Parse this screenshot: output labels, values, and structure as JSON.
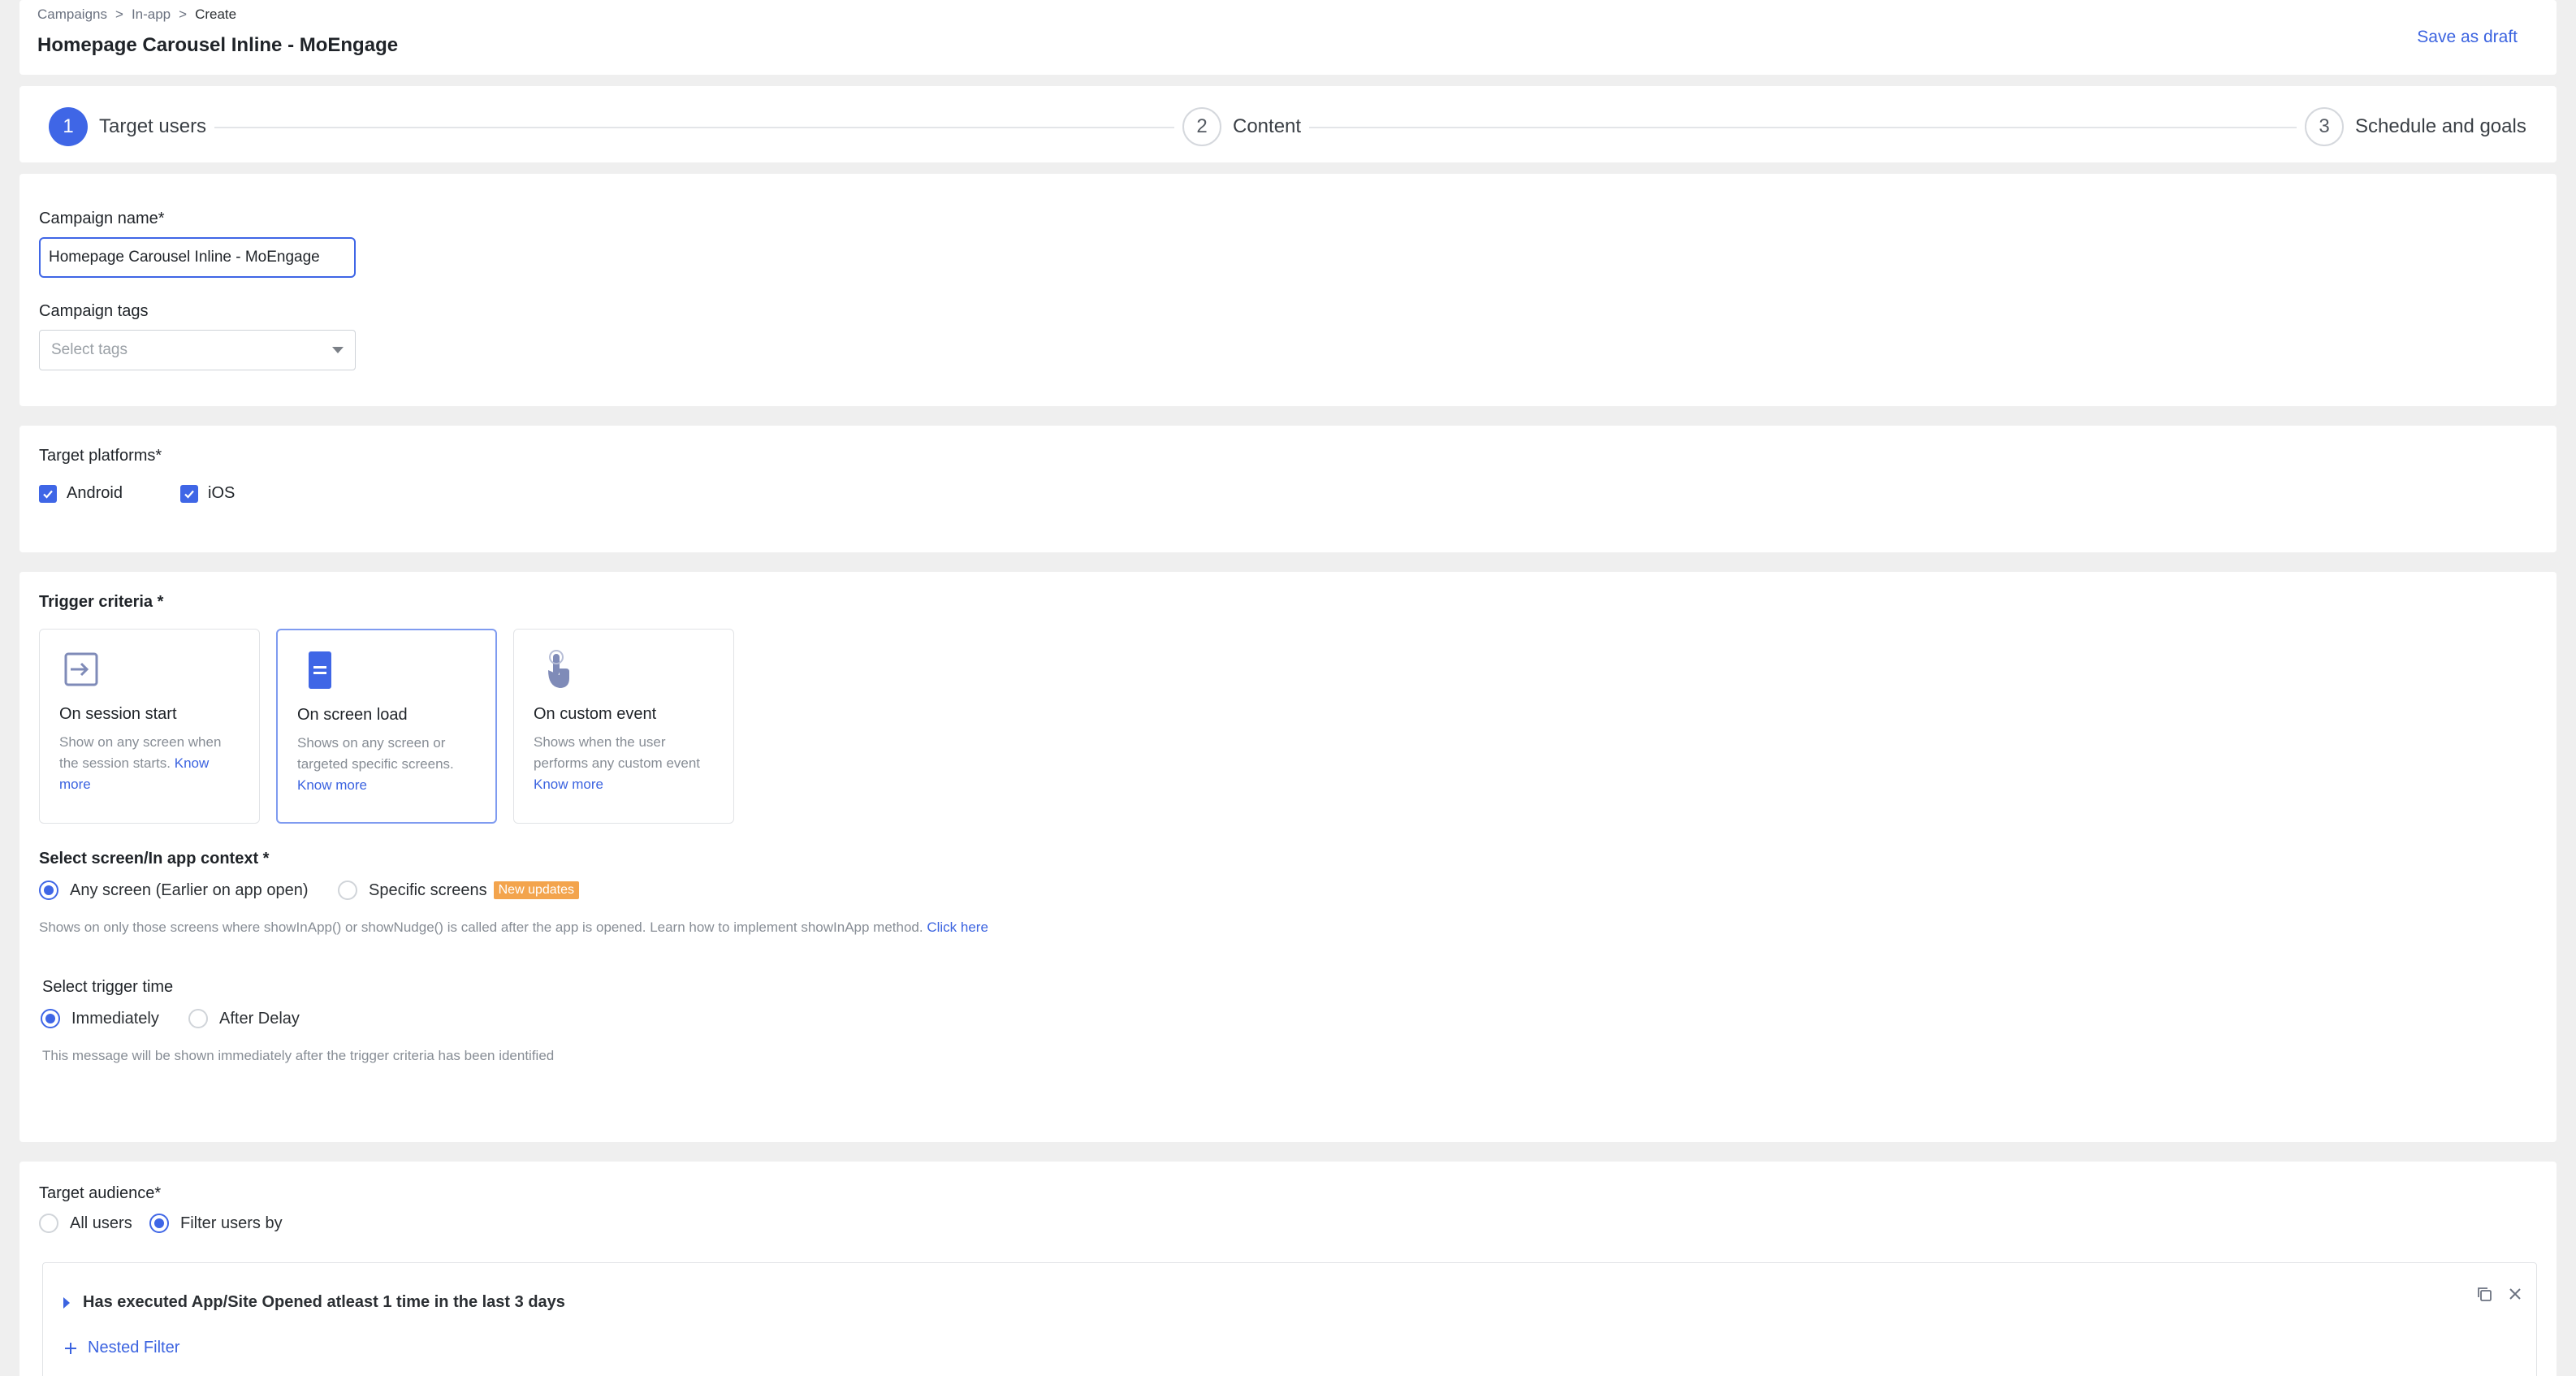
{
  "breadcrumb": [
    "Campaigns",
    ">",
    "In-app",
    ">",
    "Create"
  ],
  "page_title": "Homepage Carousel Inline - MoEngage",
  "save_draft_label": "Save as draft",
  "steps": [
    {
      "number": "1",
      "label": "Target users",
      "state": "active"
    },
    {
      "number": "2",
      "label": "Content",
      "state": "idle"
    },
    {
      "number": "3",
      "label": "Schedule and goals",
      "state": "idle"
    }
  ],
  "campaign": {
    "name_label": "Campaign name*",
    "name_value": "Homepage Carousel Inline - MoEngage",
    "tags_label": "Campaign tags",
    "tags_placeholder": "Select tags"
  },
  "platforms": {
    "label": "Target platforms*",
    "options": [
      {
        "label": "Android",
        "checked": true
      },
      {
        "label": "iOS",
        "checked": true
      }
    ]
  },
  "trigger": {
    "label": "Trigger criteria *",
    "cards": [
      {
        "title": "On session start",
        "desc": "Show on any screen when the session starts.",
        "link": "Know more",
        "icon": "session-start-icon",
        "selected": false
      },
      {
        "title": "On screen load",
        "desc": "Shows on any screen or targeted specific screens.",
        "link": "Know more",
        "icon": "screen-load-icon",
        "selected": true
      },
      {
        "title": "On custom event",
        "desc": "Shows when the user performs any custom event",
        "link": "Know more",
        "icon": "custom-event-icon",
        "selected": false
      }
    ],
    "context_label": "Select screen/In app context *",
    "context_options": [
      {
        "label": "Any screen (Earlier on app open)",
        "selected": true
      },
      {
        "label": "Specific screens",
        "selected": false,
        "badge": "New updates"
      }
    ],
    "context_hint": "Shows on only those screens where showInApp() or showNudge() is called after the app is opened. Learn how to implement showInApp method.",
    "context_hint_link": "Click here",
    "time_label": "Select trigger time",
    "time_options": [
      {
        "label": "Immediately",
        "selected": true
      },
      {
        "label": "After Delay",
        "selected": false
      }
    ],
    "time_hint": "This message will be shown immediately after the trigger criteria has been identified"
  },
  "audience": {
    "label": "Target audience*",
    "options": [
      {
        "label": "All users",
        "selected": false
      },
      {
        "label": "Filter users by",
        "selected": true
      }
    ],
    "filter_text": "Has executed App/Site Opened atleast 1 time in the last 3 days",
    "nested_filter_label": "Nested Filter"
  },
  "colors": {
    "accent": "#3f66e6",
    "link": "#3b63e0",
    "badge": "#f3a44d"
  }
}
